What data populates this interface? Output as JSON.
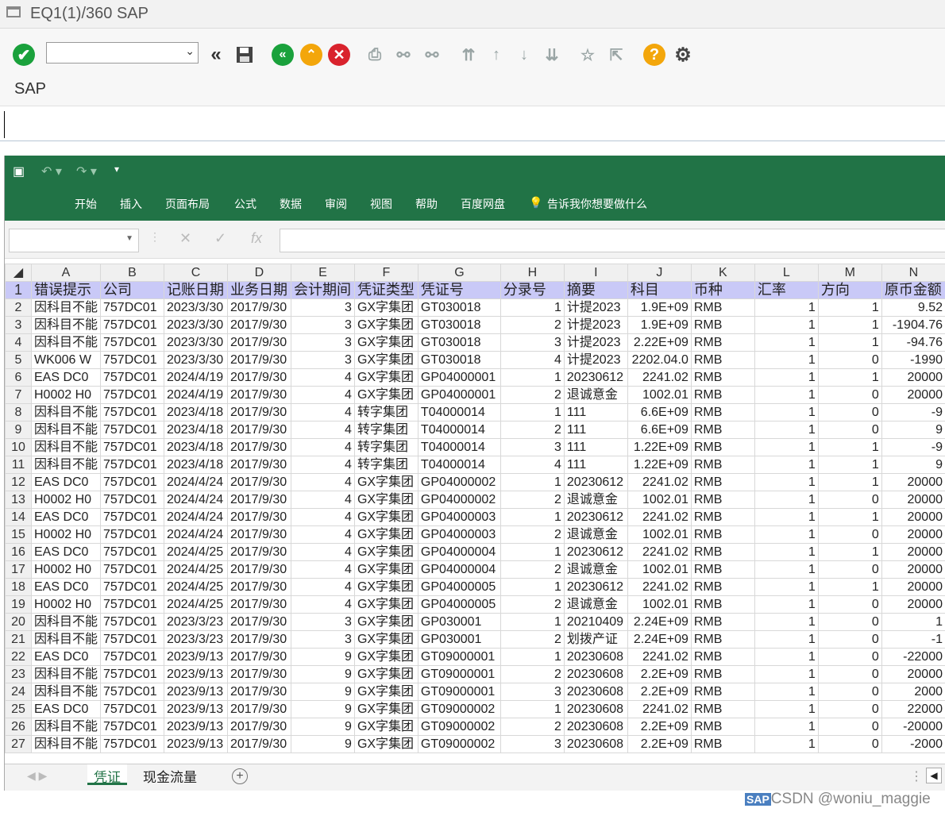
{
  "window": {
    "title": "EQ1(1)/360 SAP"
  },
  "sap": {
    "header": "SAP"
  },
  "excel": {
    "menu": [
      "开始",
      "插入",
      "页面布局",
      "公式",
      "数据",
      "审阅",
      "视图",
      "帮助",
      "百度网盘"
    ],
    "tell_me": "告诉我你想要做什么",
    "fx": "fx",
    "col_letters": [
      "A",
      "B",
      "C",
      "D",
      "E",
      "F",
      "G",
      "H",
      "I",
      "J",
      "K",
      "L",
      "M",
      "N"
    ],
    "header_row": [
      "错误提示",
      "公司",
      "记账日期",
      "业务日期",
      "会计期间",
      "凭证类型",
      "凭证号",
      "分录号",
      "摘要",
      "科目",
      "币种",
      "汇率",
      "方向",
      "原币金额"
    ],
    "rows": [
      [
        "因科目不能",
        "757DC01",
        "2023/3/30",
        "2017/9/30",
        "3",
        "GX字集团",
        "GT030018",
        "1",
        "计提2023",
        "1.9E+09",
        "RMB",
        "1",
        "1",
        "9.52"
      ],
      [
        "因科目不能",
        "757DC01",
        "2023/3/30",
        "2017/9/30",
        "3",
        "GX字集团",
        "GT030018",
        "2",
        "计提2023",
        "1.9E+09",
        "RMB",
        "1",
        "1",
        "-1904.76"
      ],
      [
        "因科目不能",
        "757DC01",
        "2023/3/30",
        "2017/9/30",
        "3",
        "GX字集团",
        "GT030018",
        "3",
        "计提2023",
        "2.22E+09",
        "RMB",
        "1",
        "1",
        "-94.76"
      ],
      [
        "WK006 W",
        "757DC01",
        "2023/3/30",
        "2017/9/30",
        "3",
        "GX字集团",
        "GT030018",
        "4",
        "计提2023",
        "2202.04.0",
        "RMB",
        "1",
        "0",
        "-1990"
      ],
      [
        "EAS DC0",
        "757DC01",
        "2024/4/19",
        "2017/9/30",
        "4",
        "GX字集团",
        "GP04000001",
        "1",
        "20230612",
        "2241.02",
        "RMB",
        "1",
        "1",
        "20000"
      ],
      [
        "H0002 H0",
        "757DC01",
        "2024/4/19",
        "2017/9/30",
        "4",
        "GX字集团",
        "GP04000001",
        "2",
        "退诚意金",
        "1002.01",
        "RMB",
        "1",
        "0",
        "20000"
      ],
      [
        "因科目不能",
        "757DC01",
        "2023/4/18",
        "2017/9/30",
        "4",
        "转字集团",
        "T04000014",
        "1",
        "111",
        "6.6E+09",
        "RMB",
        "1",
        "0",
        "-9"
      ],
      [
        "因科目不能",
        "757DC01",
        "2023/4/18",
        "2017/9/30",
        "4",
        "转字集团",
        "T04000014",
        "2",
        "111",
        "6.6E+09",
        "RMB",
        "1",
        "0",
        "9"
      ],
      [
        "因科目不能",
        "757DC01",
        "2023/4/18",
        "2017/9/30",
        "4",
        "转字集团",
        "T04000014",
        "3",
        "111",
        "1.22E+09",
        "RMB",
        "1",
        "1",
        "-9"
      ],
      [
        "因科目不能",
        "757DC01",
        "2023/4/18",
        "2017/9/30",
        "4",
        "转字集团",
        "T04000014",
        "4",
        "111",
        "1.22E+09",
        "RMB",
        "1",
        "1",
        "9"
      ],
      [
        "EAS DC0",
        "757DC01",
        "2024/4/24",
        "2017/9/30",
        "4",
        "GX字集团",
        "GP04000002",
        "1",
        "20230612",
        "2241.02",
        "RMB",
        "1",
        "1",
        "20000"
      ],
      [
        "H0002 H0",
        "757DC01",
        "2024/4/24",
        "2017/9/30",
        "4",
        "GX字集团",
        "GP04000002",
        "2",
        "退诚意金",
        "1002.01",
        "RMB",
        "1",
        "0",
        "20000"
      ],
      [
        "EAS DC0",
        "757DC01",
        "2024/4/24",
        "2017/9/30",
        "4",
        "GX字集团",
        "GP04000003",
        "1",
        "20230612",
        "2241.02",
        "RMB",
        "1",
        "1",
        "20000"
      ],
      [
        "H0002 H0",
        "757DC01",
        "2024/4/24",
        "2017/9/30",
        "4",
        "GX字集团",
        "GP04000003",
        "2",
        "退诚意金",
        "1002.01",
        "RMB",
        "1",
        "0",
        "20000"
      ],
      [
        "EAS DC0",
        "757DC01",
        "2024/4/25",
        "2017/9/30",
        "4",
        "GX字集团",
        "GP04000004",
        "1",
        "20230612",
        "2241.02",
        "RMB",
        "1",
        "1",
        "20000"
      ],
      [
        "H0002 H0",
        "757DC01",
        "2024/4/25",
        "2017/9/30",
        "4",
        "GX字集团",
        "GP04000004",
        "2",
        "退诚意金",
        "1002.01",
        "RMB",
        "1",
        "0",
        "20000"
      ],
      [
        "EAS DC0",
        "757DC01",
        "2024/4/25",
        "2017/9/30",
        "4",
        "GX字集团",
        "GP04000005",
        "1",
        "20230612",
        "2241.02",
        "RMB",
        "1",
        "1",
        "20000"
      ],
      [
        "H0002 H0",
        "757DC01",
        "2024/4/25",
        "2017/9/30",
        "4",
        "GX字集团",
        "GP04000005",
        "2",
        "退诚意金",
        "1002.01",
        "RMB",
        "1",
        "0",
        "20000"
      ],
      [
        "因科目不能",
        "757DC01",
        "2023/3/23",
        "2017/9/30",
        "3",
        "GX字集团",
        "GP030001",
        "1",
        "20210409",
        "2.24E+09",
        "RMB",
        "1",
        "0",
        "1"
      ],
      [
        "因科目不能",
        "757DC01",
        "2023/3/23",
        "2017/9/30",
        "3",
        "GX字集团",
        "GP030001",
        "2",
        "划拨产证",
        "2.24E+09",
        "RMB",
        "1",
        "0",
        "-1"
      ],
      [
        "EAS DC0",
        "757DC01",
        "2023/9/13",
        "2017/9/30",
        "9",
        "GX字集团",
        "GT09000001",
        "1",
        "20230608",
        "2241.02",
        "RMB",
        "1",
        "0",
        "-22000"
      ],
      [
        "因科目不能",
        "757DC01",
        "2023/9/13",
        "2017/9/30",
        "9",
        "GX字集团",
        "GT09000001",
        "2",
        "20230608",
        "2.2E+09",
        "RMB",
        "1",
        "0",
        "20000"
      ],
      [
        "因科目不能",
        "757DC01",
        "2023/9/13",
        "2017/9/30",
        "9",
        "GX字集团",
        "GT09000001",
        "3",
        "20230608",
        "2.2E+09",
        "RMB",
        "1",
        "0",
        "2000"
      ],
      [
        "EAS DC0",
        "757DC01",
        "2023/9/13",
        "2017/9/30",
        "9",
        "GX字集团",
        "GT09000002",
        "1",
        "20230608",
        "2241.02",
        "RMB",
        "1",
        "0",
        "22000"
      ],
      [
        "因科目不能",
        "757DC01",
        "2023/9/13",
        "2017/9/30",
        "9",
        "GX字集团",
        "GT09000002",
        "2",
        "20230608",
        "2.2E+09",
        "RMB",
        "1",
        "0",
        "-20000"
      ],
      [
        "因科目不能",
        "757DC01",
        "2023/9/13",
        "2017/9/30",
        "9",
        "GX字集团",
        "GT09000002",
        "3",
        "20230608",
        "2.2E+09",
        "RMB",
        "1",
        "0",
        "-2000"
      ]
    ],
    "sheet_tabs": [
      "凭证",
      "现金流量"
    ]
  },
  "watermark": {
    "text": "CSDN @woniu_maggie",
    "badge": "SAP"
  },
  "colors": {
    "excel_green": "#217346",
    "header_fill": "#c9c9f7",
    "ok_green": "#1aa13c",
    "nav_green": "#1aa13c",
    "nav_yellow": "#f3a60b",
    "cancel_red": "#d9232d",
    "help": "#f3a60b"
  }
}
